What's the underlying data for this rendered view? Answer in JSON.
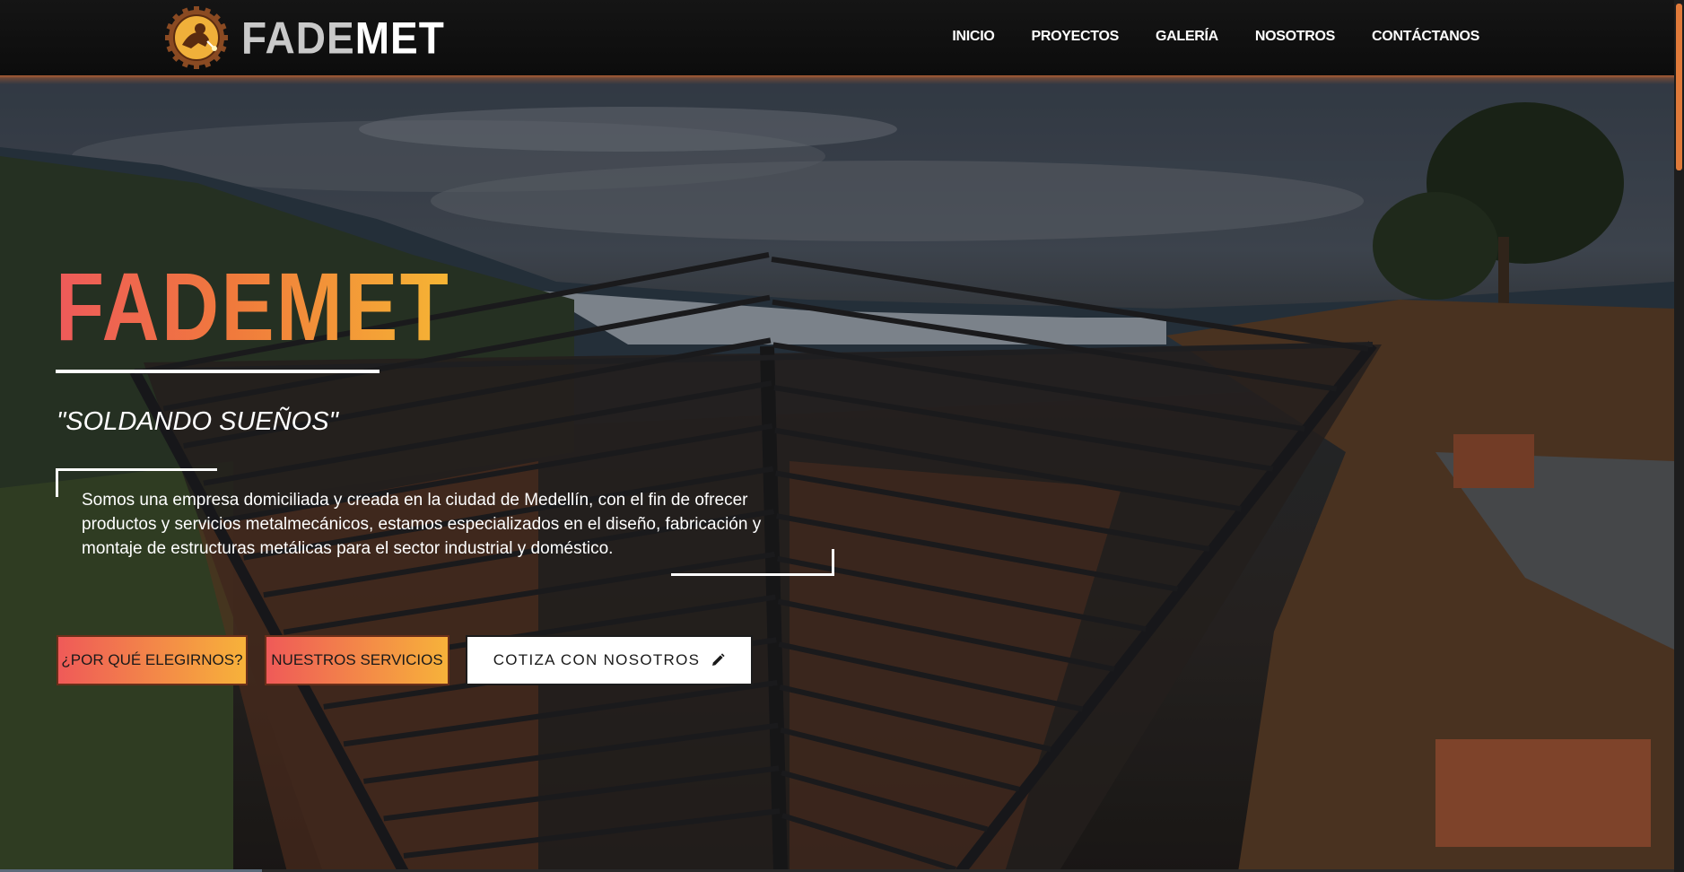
{
  "brand": {
    "logo_part1": "FADE",
    "logo_part2": "MET",
    "logo_icon": "welder-gear-emblem-icon"
  },
  "nav": {
    "items": [
      {
        "label": "INICIO"
      },
      {
        "label": "PROYECTOS"
      },
      {
        "label": "GALERÍA"
      },
      {
        "label": "NOSOTROS"
      },
      {
        "label": "CONTÁCTANOS"
      }
    ]
  },
  "hero": {
    "title": "FADEMET",
    "slogan": "\"SOLDANDO SUEÑOS\"",
    "description": "Somos una empresa domiciliada y creada en la ciudad de Medellín, con el fin de ofrecer productos y servicios metalmecánicos, estamos especializados en el diseño, fabricación y montaje de estructuras metálicas para el sector industrial y doméstico.",
    "buttons": {
      "why": "¿POR QUÉ ELEGIRNOS?",
      "services": "NUESTROS SERVICIOS",
      "quote": "COTIZA CON NOSOTROS",
      "quote_icon": "pencil-icon"
    },
    "background": "steel-roof-structure-photo"
  },
  "colors": {
    "accent_orange": "#e07a3a",
    "gradient_start": "#ef5a58",
    "gradient_end": "#f7b23a",
    "header_bg": "#111111"
  }
}
